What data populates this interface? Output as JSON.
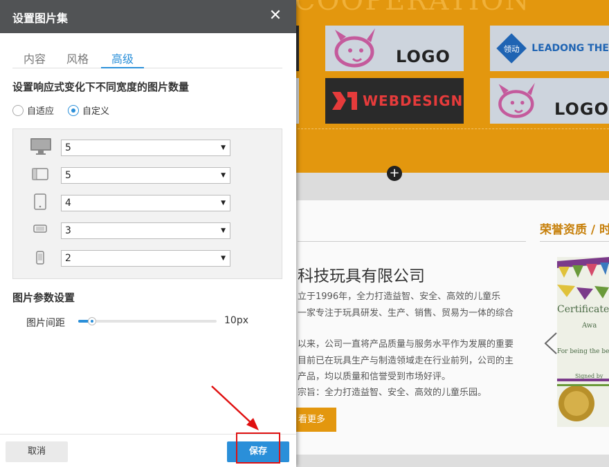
{
  "background": {
    "banner_title": "COOPERATION",
    "logos": [
      "LOGO",
      "LEADONG THE",
      "WEBDESIGN",
      "LOGO"
    ],
    "logo_seal_text": "领动",
    "honor_title": "荣誉资质 / 时",
    "company_name": "科技玩具有限公司",
    "intro_lines": [
      "立于1996年，全力打造益智、安全、高效的儿童乐",
      "一家专注于玩具研发、生产、销售、贸易为一体的综合",
      "以来，公司一直将产品质量与服务水平作为发展的重要",
      "目前已在玩具生产与制造领域走在行业前列，公司的主",
      "产品，均以质量和信誉受到市场好评。",
      "宗旨：全力打造益智、安全、高效的儿童乐园。"
    ],
    "more_button": "看更多",
    "certificate": {
      "title": "Certificate o",
      "line1": "Awa",
      "line2": "For being the best",
      "line3": "Signed by"
    }
  },
  "dialog": {
    "title": "设置图片集",
    "close_glyph": "✕",
    "tabs": [
      {
        "label": "内容",
        "active": false
      },
      {
        "label": "风格",
        "active": false
      },
      {
        "label": "高级",
        "active": true
      }
    ],
    "responsive_section_title": "设置响应式变化下不同宽度的图片数量",
    "radio_options": [
      {
        "label": "自适应",
        "checked": false
      },
      {
        "label": "自定义",
        "checked": true
      }
    ],
    "device_rows": [
      {
        "icon": "desktop-icon",
        "value": "5"
      },
      {
        "icon": "laptop-icon",
        "value": "5"
      },
      {
        "icon": "tablet-icon",
        "value": "4"
      },
      {
        "icon": "tablet-landscape-icon",
        "value": "3"
      },
      {
        "icon": "phone-icon",
        "value": "2"
      }
    ],
    "params_section_title": "图片参数设置",
    "spacing_label": "图片间距",
    "spacing_value": "10px",
    "spacing_fraction": 0.1,
    "cancel_label": "取消",
    "save_label": "保存"
  },
  "colors": {
    "accent": "#2a8fd9",
    "header_bg": "#515355",
    "brand_orange": "#e3970e",
    "annotation_red": "#e01010"
  }
}
